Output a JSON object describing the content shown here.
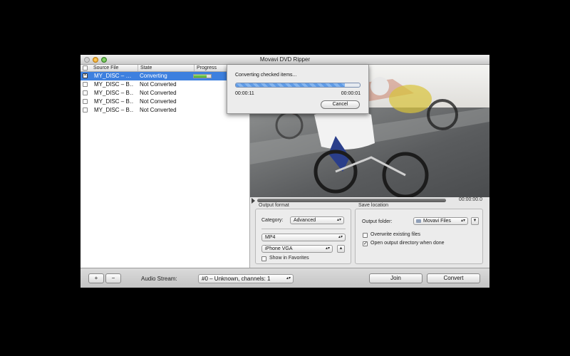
{
  "window": {
    "title": "Movavi DVD Ripper"
  },
  "file_list": {
    "columns": {
      "source": "Source File",
      "state": "State",
      "progress": "Progress"
    },
    "rows": [
      {
        "name": "MY_DISC – …",
        "state": "Converting",
        "selected": true,
        "progress": 0.75
      },
      {
        "name": "MY_DISC – B…",
        "state": "Not Converted"
      },
      {
        "name": "MY_DISC – B…",
        "state": "Not Converted"
      },
      {
        "name": "MY_DISC – B…",
        "state": "Not Converted"
      },
      {
        "name": "MY_DISC – B…",
        "state": "Not Converted"
      }
    ]
  },
  "progress_sheet": {
    "message": "Converting checked items...",
    "elapsed": "00:00:11",
    "remaining": "00:00:01",
    "cancel_label": "Cancel",
    "progress": 0.88
  },
  "preview": {
    "time": "00:00:00.0"
  },
  "output_format": {
    "label": "Output format",
    "category_label": "Category:",
    "category_value": "Advanced",
    "format_value": "MP4",
    "preset_value": "iPhone VGA",
    "favorites_label": "Show in Favorites",
    "favorites_checked": false
  },
  "save_location": {
    "label": "Save location",
    "folder_label": "Output folder:",
    "folder_value": "Movavi Files",
    "overwrite_label": "Overwrite existing files",
    "overwrite_checked": false,
    "open_dir_label": "Open output directory when done",
    "open_dir_checked": true
  },
  "bottom_bar": {
    "add_label": "+",
    "remove_label": "−",
    "audio_label": "Audio Stream:",
    "audio_value": "#0 – Unknown, channels: 1",
    "join_label": "Join",
    "convert_label": "Convert"
  },
  "colors": {
    "selection": "#3d80df",
    "progress_fill": "#5f9be6",
    "row_progress": "#3ea61f"
  },
  "icons": {
    "folder": "folder-icon",
    "up_arrows": "stepper-arrows-icon",
    "play": "play-icon"
  }
}
